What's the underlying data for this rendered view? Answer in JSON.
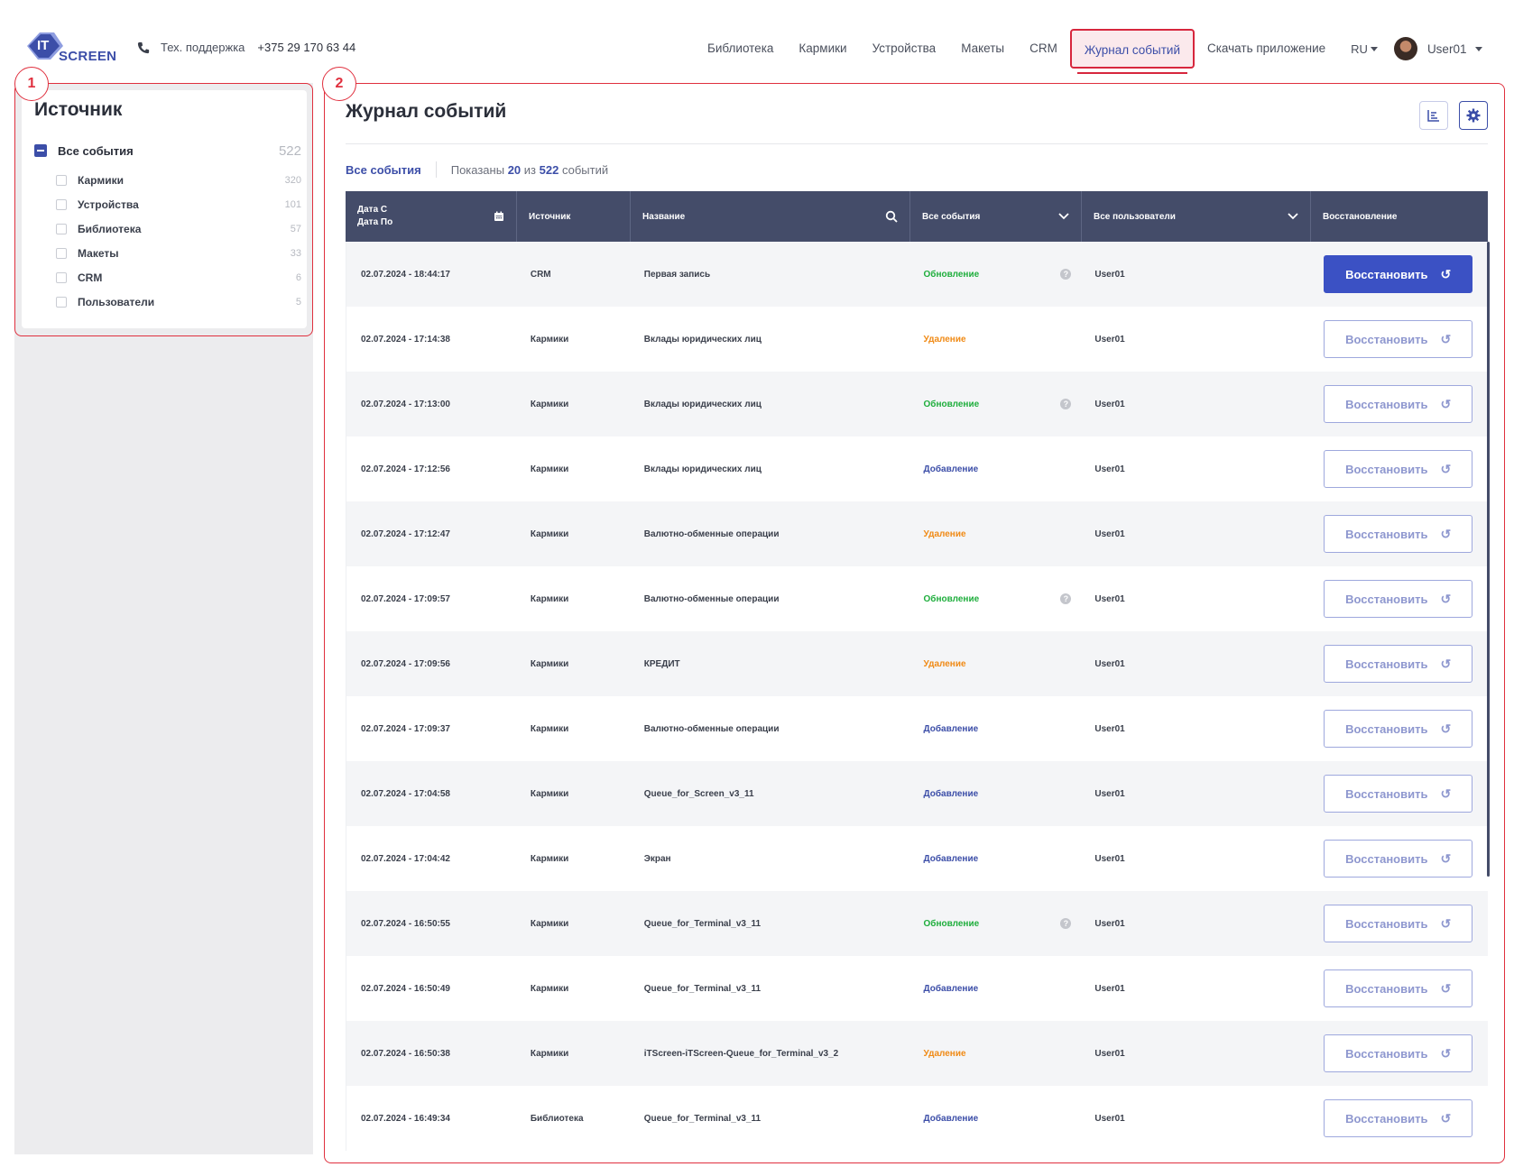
{
  "logo": {
    "it": "IT",
    "screen": "SCREEN"
  },
  "support": {
    "label": "Тех. поддержка",
    "phone": "+375 29 170 63 44"
  },
  "nav": {
    "items": [
      "Библиотека",
      "Кармики",
      "Устройства",
      "Макеты",
      "CRM",
      "Журнал событий",
      "Скачать приложение"
    ],
    "lang": "RU",
    "user": "User01"
  },
  "badges": {
    "one": "1",
    "two": "2"
  },
  "source": {
    "title": "Источник",
    "all": {
      "label": "Все события",
      "count": "522"
    },
    "items": [
      {
        "label": "Кармики",
        "count": "320"
      },
      {
        "label": "Устройства",
        "count": "101"
      },
      {
        "label": "Библиотека",
        "count": "57"
      },
      {
        "label": "Макеты",
        "count": "33"
      },
      {
        "label": "CRM",
        "count": "6"
      },
      {
        "label": "Пользователи",
        "count": "5"
      }
    ]
  },
  "main": {
    "title": "Журнал событий",
    "filter_all": "Все события",
    "shown_prefix": "Показаны",
    "shown_count": "20",
    "shown_of": "из",
    "total": "522",
    "shown_suffix": "событий"
  },
  "table": {
    "headers": {
      "date_from": "Дата С",
      "date_to": "Дата По",
      "source": "Источник",
      "name": "Название",
      "events": "Все события",
      "users": "Все пользователи",
      "restore": "Восстановление"
    },
    "restore_label": "Восстановить",
    "rows": [
      {
        "date": "02.07.2024 - 18:44:17",
        "source": "CRM",
        "name": "Первая запись",
        "event": "Обновление",
        "type": "update",
        "user": "User01"
      },
      {
        "date": "02.07.2024 - 17:14:38",
        "source": "Кармики",
        "name": "Вклады юридических лиц",
        "event": "Удаление",
        "type": "delete",
        "user": "User01"
      },
      {
        "date": "02.07.2024 - 17:13:00",
        "source": "Кармики",
        "name": "Вклады юридических лиц",
        "event": "Обновление",
        "type": "update",
        "user": "User01"
      },
      {
        "date": "02.07.2024 - 17:12:56",
        "source": "Кармики",
        "name": "Вклады юридических лиц",
        "event": "Добавление",
        "type": "add",
        "user": "User01"
      },
      {
        "date": "02.07.2024 - 17:12:47",
        "source": "Кармики",
        "name": "Валютно-обменные операции",
        "event": "Удаление",
        "type": "delete",
        "user": "User01"
      },
      {
        "date": "02.07.2024 - 17:09:57",
        "source": "Кармики",
        "name": "Валютно-обменные операции",
        "event": "Обновление",
        "type": "update",
        "user": "User01"
      },
      {
        "date": "02.07.2024 - 17:09:56",
        "source": "Кармики",
        "name": "КРЕДИТ",
        "event": "Удаление",
        "type": "delete",
        "user": "User01"
      },
      {
        "date": "02.07.2024 - 17:09:37",
        "source": "Кармики",
        "name": "Валютно-обменные операции",
        "event": "Добавление",
        "type": "add",
        "user": "User01"
      },
      {
        "date": "02.07.2024 - 17:04:58",
        "source": "Кармики",
        "name": "Queue_for_Screen_v3_11",
        "event": "Добавление",
        "type": "add",
        "user": "User01"
      },
      {
        "date": "02.07.2024 - 17:04:42",
        "source": "Кармики",
        "name": "Экран",
        "event": "Добавление",
        "type": "add",
        "user": "User01"
      },
      {
        "date": "02.07.2024 - 16:50:55",
        "source": "Кармики",
        "name": "Queue_for_Terminal_v3_11",
        "event": "Обновление",
        "type": "update",
        "user": "User01"
      },
      {
        "date": "02.07.2024 - 16:50:49",
        "source": "Кармики",
        "name": "Queue_for_Terminal_v3_11",
        "event": "Добавление",
        "type": "add",
        "user": "User01"
      },
      {
        "date": "02.07.2024 - 16:50:38",
        "source": "Кармики",
        "name": "iTScreen-iTScreen-Queue_for_Terminal_v3_2",
        "event": "Удаление",
        "type": "delete",
        "user": "User01"
      },
      {
        "date": "02.07.2024 - 16:49:34",
        "source": "Библиотека",
        "name": "Queue_for_Terminal_v3_11",
        "event": "Добавление",
        "type": "add",
        "user": "User01"
      }
    ]
  },
  "colors": {
    "accent": "#3c4ea8",
    "header_bg": "#444c69",
    "update": "#1fae3d",
    "delete": "#f08a15",
    "add": "#3c4ea8",
    "annotation": "#e0303e"
  }
}
